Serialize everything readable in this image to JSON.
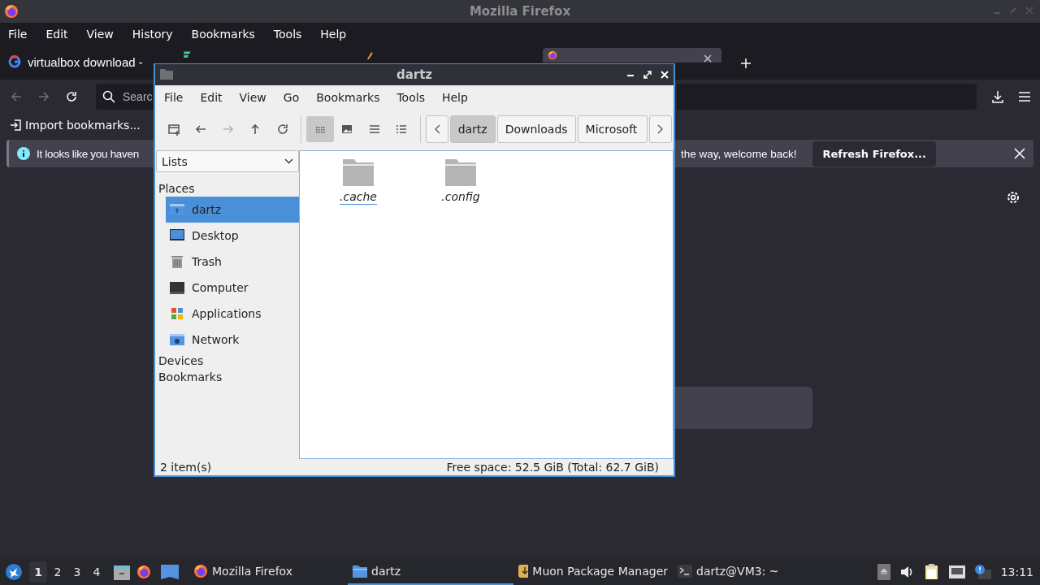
{
  "browser": {
    "title": "Mozilla Firefox",
    "menu": [
      "File",
      "Edit",
      "View",
      "History",
      "Bookmarks",
      "Tools",
      "Help"
    ],
    "tabs": [
      {
        "label": "virtualbox download -",
        "kind": "google",
        "selected": false
      },
      {
        "kind": "filecr",
        "selected": false
      },
      {
        "kind": "article",
        "selected": false
      },
      {
        "kind": "firefox",
        "selected": true
      }
    ],
    "search": {
      "placeholder": "Searc"
    },
    "bookmarks": [
      "Import bookmarks..."
    ],
    "notification": {
      "text_start": "It looks like you haven",
      "text_end": "the way, welcome back!",
      "button": "Refresh Firefox..."
    }
  },
  "file_manager": {
    "title": "dartz",
    "menu": [
      "File",
      "Edit",
      "View",
      "Go",
      "Bookmarks",
      "Tools",
      "Help"
    ],
    "toolbar": [
      {
        "kind": "new-tab",
        "disabled": false
      },
      {
        "kind": "back",
        "disabled": false
      },
      {
        "kind": "forward",
        "disabled": true
      },
      {
        "kind": "up",
        "disabled": false
      },
      {
        "kind": "reload",
        "disabled": false
      }
    ],
    "view_modes": [
      {
        "kind": "icons",
        "selected": true
      },
      {
        "kind": "thumbnails",
        "selected": false
      },
      {
        "kind": "compact",
        "selected": false
      },
      {
        "kind": "details",
        "selected": false
      }
    ],
    "path": [
      {
        "label": "dartz",
        "selected": true
      },
      {
        "label": "Downloads",
        "selected": false
      },
      {
        "label": "Microsoft",
        "selected": false
      }
    ],
    "side_pane": {
      "mode": "Lists",
      "sections": [
        {
          "title": "Places",
          "items": [
            {
              "label": "dartz",
              "kind": "home",
              "selected": true
            },
            {
              "label": "Desktop",
              "kind": "desktop",
              "selected": false
            },
            {
              "label": "Trash",
              "kind": "trash",
              "selected": false
            },
            {
              "label": "Computer",
              "kind": "computer",
              "selected": false
            },
            {
              "label": "Applications",
              "kind": "applications",
              "selected": false
            },
            {
              "label": "Network",
              "kind": "network",
              "selected": false
            }
          ]
        },
        {
          "title": "Devices"
        },
        {
          "title": "Bookmarks"
        }
      ]
    },
    "files": [
      {
        "name": ".cache",
        "selected": true
      },
      {
        "name": ".config",
        "selected": false
      }
    ],
    "status": {
      "items": "2 item(s)",
      "space": "Free space: 52.5 GiB (Total: 62.7 GiB)"
    }
  },
  "taskbar": {
    "workspaces": [
      {
        "label": "1",
        "selected": true
      },
      {
        "label": "2",
        "selected": false
      },
      {
        "label": "3",
        "selected": false
      },
      {
        "label": "4",
        "selected": false
      }
    ],
    "tasks": [
      {
        "label": "Mozilla Firefox",
        "kind": "firefox",
        "selected": false
      },
      {
        "label": "dartz",
        "kind": "folder",
        "selected": true
      },
      {
        "label": "Muon Package Manager",
        "kind": "package",
        "selected": false
      },
      {
        "label": "dartz@VM3: ~",
        "kind": "terminal",
        "selected": false
      }
    ],
    "clock": "13:11"
  }
}
